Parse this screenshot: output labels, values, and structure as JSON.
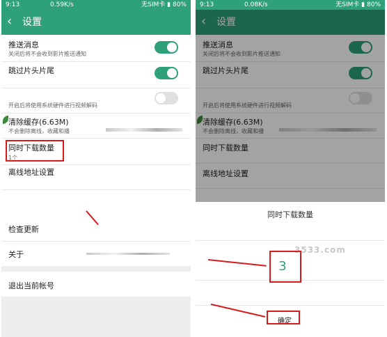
{
  "left": {
    "status": {
      "time": "9:13",
      "net": "0.59K/s",
      "sim": "无SIM卡",
      "battery": "80%"
    },
    "appbar": {
      "back": "‹",
      "title": "设置"
    },
    "rows": [
      {
        "title": "推送消息",
        "sub": "关闭后将不会收到影片推送通知",
        "toggle": "on"
      },
      {
        "title": "跳过片头片尾",
        "sub": "",
        "toggle": "on"
      },
      {
        "title": "",
        "sub": "开启后将使用系统硬件进行视频解码",
        "toggle": "off"
      },
      {
        "title": "清除缓存(6.63M)",
        "sub": "不会删除离线，收藏和播"
      },
      {
        "title": "同时下载数量",
        "sub": "1个"
      },
      {
        "title": "离线地址设置",
        "sub": ""
      }
    ],
    "more": [
      {
        "title": "检查更新"
      },
      {
        "title": "关于"
      },
      {
        "title": "退出当前帐号"
      }
    ]
  },
  "right": {
    "status": {
      "time": "9:13",
      "net": "0.08K/s",
      "sim": "无SIM卡",
      "battery": "80%"
    },
    "appbar": {
      "back": "‹",
      "title": "设置"
    },
    "rows": [
      {
        "title": "推送消息",
        "sub": "关闭后将不会收到影片推送通知",
        "toggle": "on"
      },
      {
        "title": "跳过片头片尾",
        "sub": "",
        "toggle": "on"
      },
      {
        "title": "",
        "sub": "开启后将使用系统硬件进行视频解码",
        "toggle": "off"
      },
      {
        "title": "清除缓存(6.63M)",
        "sub": "不会删除离线，收藏和播"
      },
      {
        "title": "同时下载数量",
        "sub": ""
      },
      {
        "title": "离线地址设置",
        "sub": ""
      }
    ],
    "dialog": {
      "title": "同时下载数量",
      "selected": "3",
      "confirm": "确定",
      "watermark": "3533.com"
    }
  }
}
